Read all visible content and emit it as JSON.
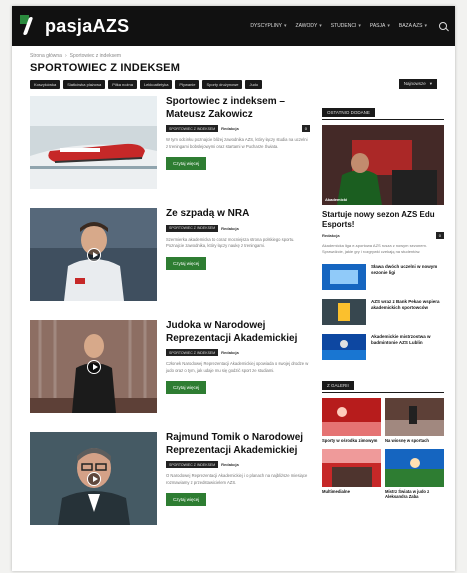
{
  "header": {
    "logo_text": "pasjaAZS",
    "nav": [
      {
        "label": "Dyscypliny"
      },
      {
        "label": "Zawody"
      },
      {
        "label": "Studenci"
      },
      {
        "label": "Pasja"
      },
      {
        "label": "Baza AZS"
      }
    ]
  },
  "breadcrumb": [
    "Strona główna",
    "Sportowiec z indeksem"
  ],
  "page_title": "SPORTOWIEC Z INDEKSEM",
  "tags": [
    "Koszykówka",
    "Siatkówka plażowa",
    "Piłka nożna",
    "Lekkoatletyka",
    "Pływanie",
    "Sporty drużynowe",
    "Judo"
  ],
  "sort": {
    "label": "Najnowsze",
    "chevron": "▾"
  },
  "articles": [
    {
      "title": "Sportowiec z indeksem – Mateusz Zakowicz",
      "category": "SPORTOWIEC Z INDEKSEM",
      "author": "Redakcja",
      "date": "",
      "comments": "0",
      "excerpt": "W tym odcinku poznajcie bliżej zawodnika AZS, który łączy studia na uczelni z treningami bobslejowymi oraz startami w Pucharze Świata.",
      "button": "Czytaj więcej",
      "image": "bobsleigh",
      "has_video": false
    },
    {
      "title": "Ze szpadą w NRA",
      "category": "SPORTOWIEC Z INDEKSEM",
      "author": "Redakcja",
      "date": "",
      "comments": "",
      "excerpt": "Szermierka akademicka to coraz mocniejsza strona polskiego sportu. Poznajcie zawodnika, który łączy naukę z treningami.",
      "button": "Czytaj więcej",
      "image": "fencer",
      "has_video": true
    },
    {
      "title": "Judoka w Narodowej Reprezentacji Akademickiej",
      "category": "SPORTOWIEC Z INDEKSEM",
      "author": "Redakcja",
      "date": "",
      "comments": "",
      "excerpt": "Członek Narodowej Reprezentacji Akademickiej opowiada o swojej drodze w judo oraz o tym, jak udaje mu się godzić sport ze studiami.",
      "button": "Czytaj więcej",
      "image": "judoka",
      "has_video": true
    },
    {
      "title": "Rajmund Tomik o Narodowej Reprezentacji Akademickiej",
      "category": "SPORTOWIEC Z INDEKSEM",
      "author": "Redakcja",
      "date": "",
      "comments": "",
      "excerpt": "O Narodowej Reprezentacji Akademickiej i o planach na najbliższe miesiące rozmawiamy z przedstawicielem AZS.",
      "button": "Czytaj więcej",
      "image": "portrait",
      "has_video": true
    }
  ],
  "sidebar": {
    "featured_heading": "Ostatnio dodane",
    "featured": {
      "caption": "Akademicki",
      "title": "Startuje nowy sezon AZS Edu Esports!",
      "author": "Redakcja",
      "date": "",
      "comments": "0",
      "excerpt": "Akademicka liga e-sportowa AZS rusza z nowym sezonem. Sprawdźcie, jakie gry i rozgrywki czekają na studentów."
    },
    "list": [
      {
        "title": "Sława dwóch uczelni w nowym sezonie ligi",
        "date": "",
        "image": "blue"
      },
      {
        "title": "AZS wraz z Bank Pekao wspiera akademickich sportowców",
        "date": "",
        "image": "trophy"
      },
      {
        "title": "Akademickie mistrzostwa w badmintonie AZS Lublin",
        "date": "",
        "image": "badminton"
      }
    ],
    "grid_heading": "Z galerii",
    "grid": [
      {
        "title": "Sporty w ośrodku zimowym",
        "image": "redteam"
      },
      {
        "title": "Na wiosnę w sportach",
        "image": "court"
      },
      {
        "title": "Multimedialne",
        "image": "crowd"
      },
      {
        "title": "Mistrz Świata w judo z Aleksandra Zaba",
        "image": "field"
      }
    ]
  }
}
